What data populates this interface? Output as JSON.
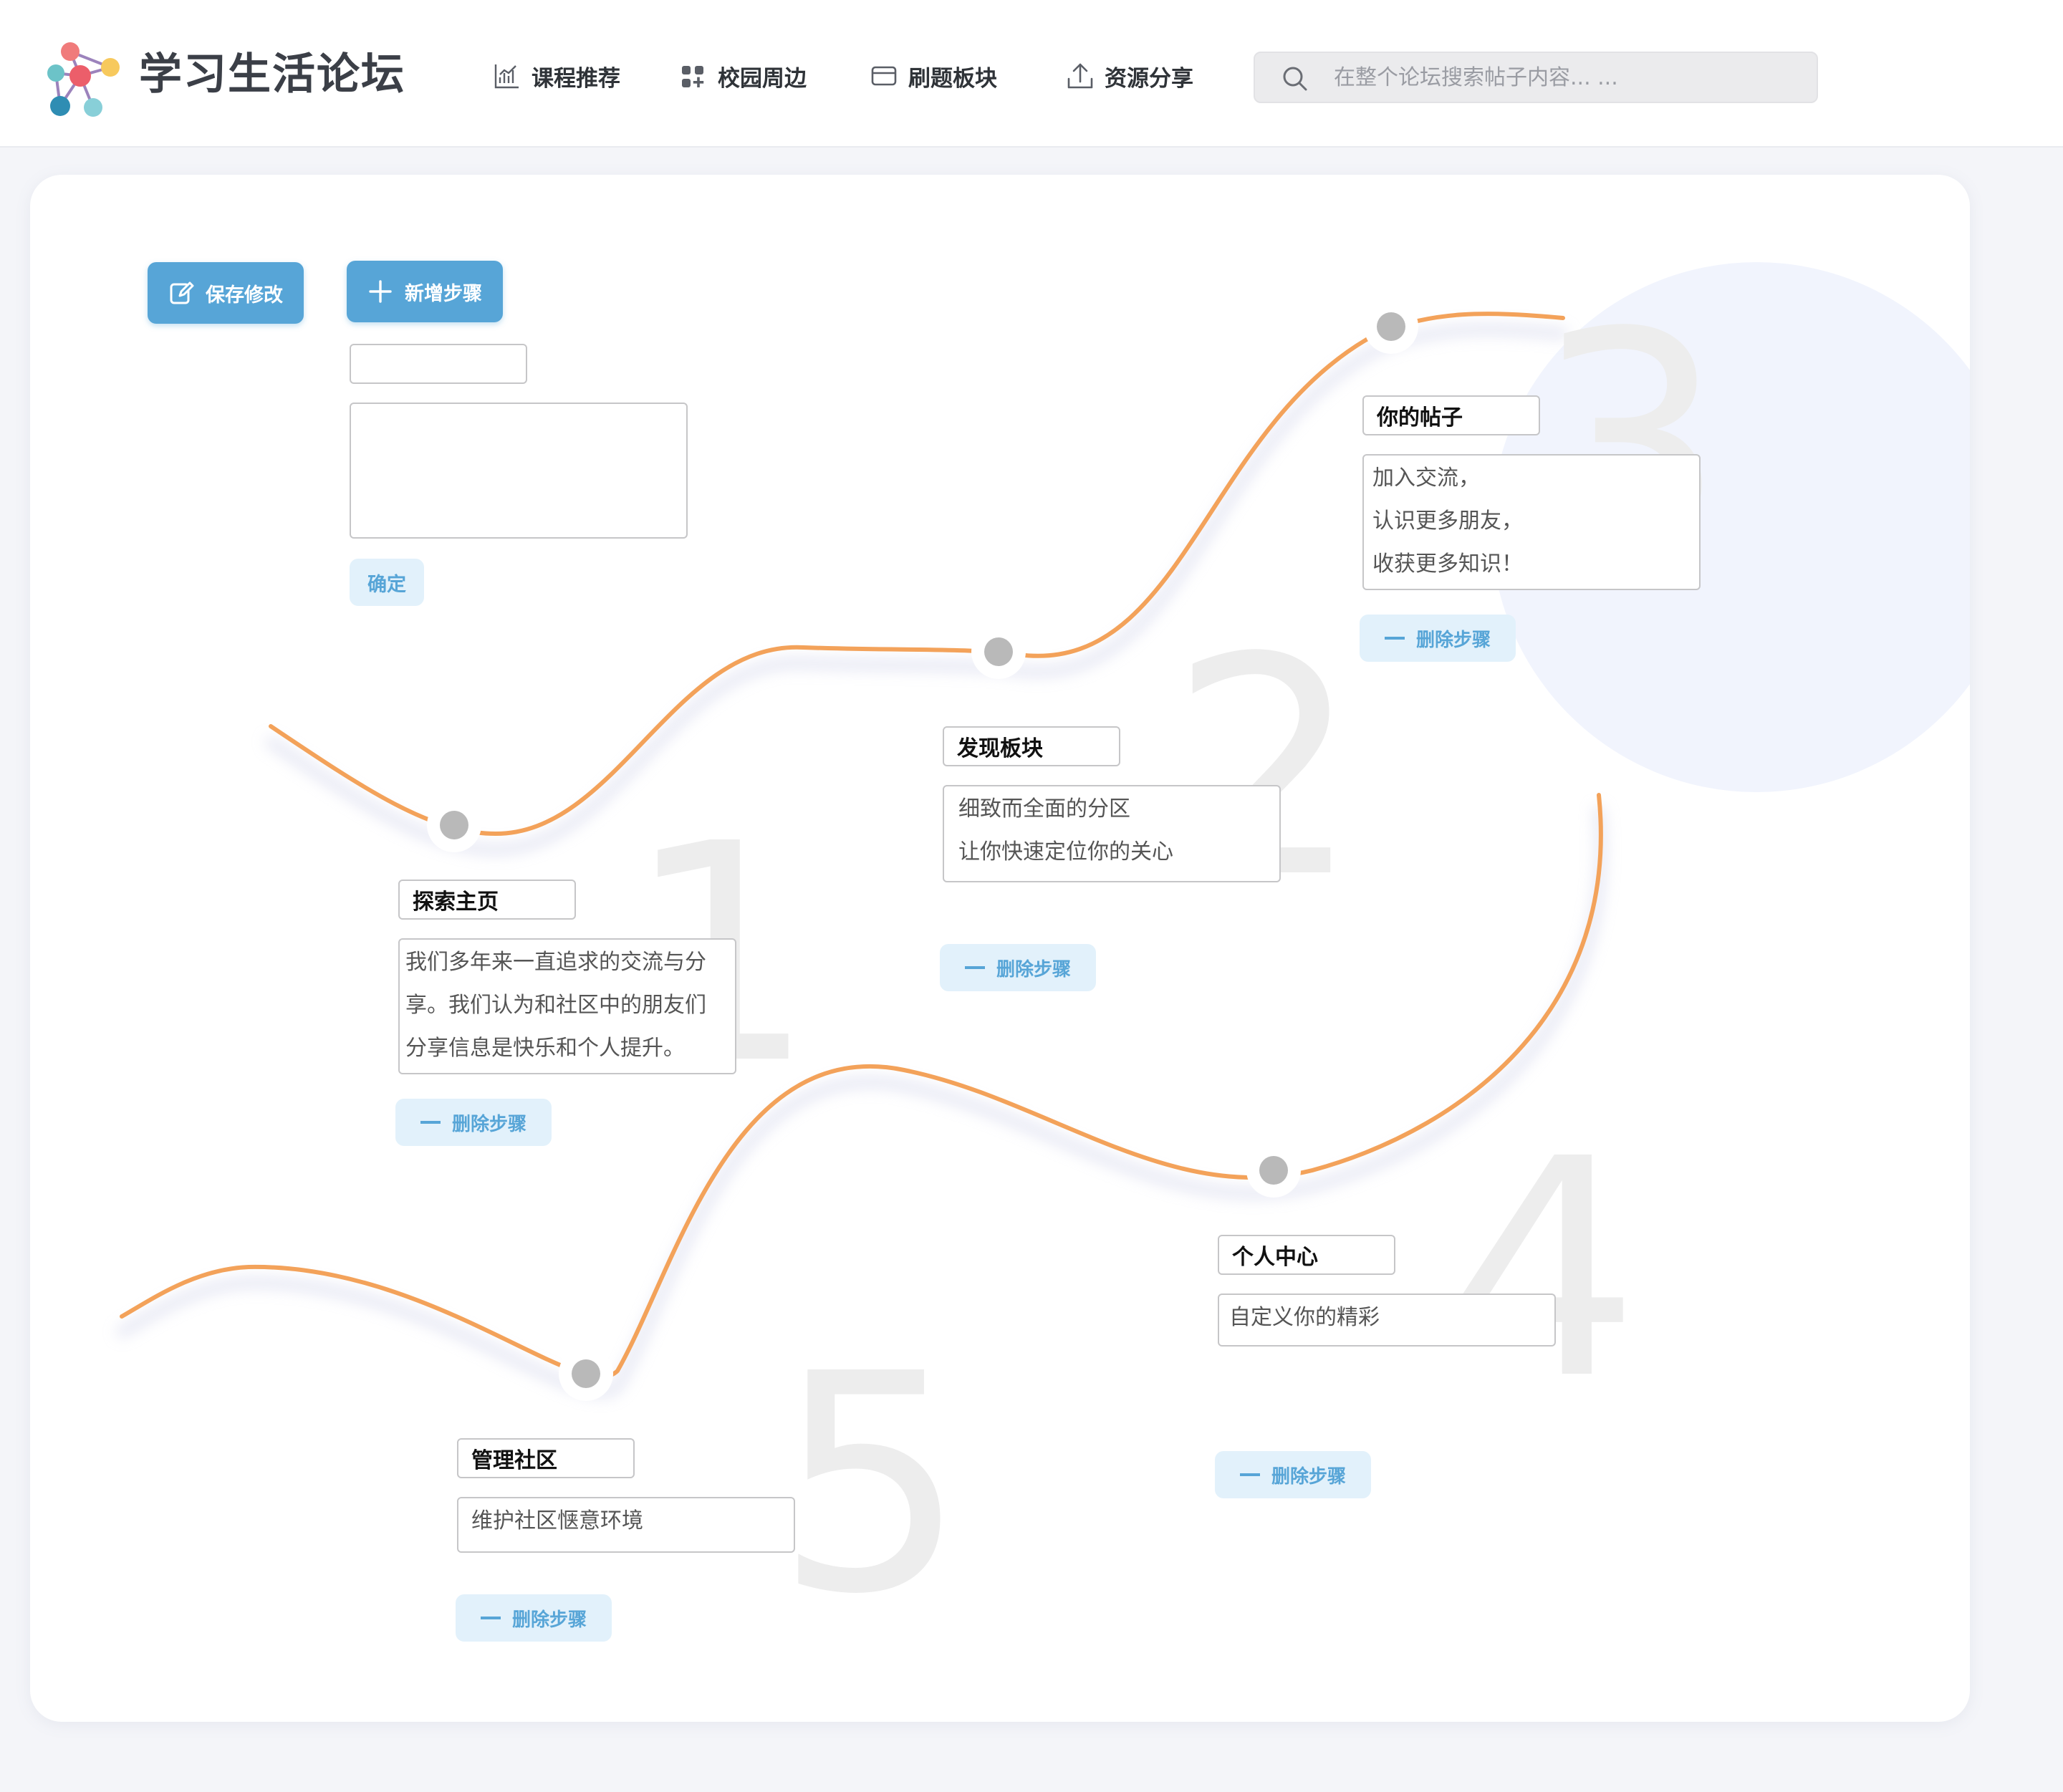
{
  "header": {
    "site_title": "学习生活论坛",
    "nav": [
      {
        "label": "课程推荐",
        "icon": "chart-icon"
      },
      {
        "label": "校园周边",
        "icon": "apps-icon"
      },
      {
        "label": "刷题板块",
        "icon": "card-icon"
      },
      {
        "label": "资源分享",
        "icon": "upload-icon"
      }
    ],
    "search_placeholder": "在整个论坛搜索帖子内容... ..."
  },
  "toolbar": {
    "save_label": "保存修改",
    "add_label": "新增步骤"
  },
  "new_step": {
    "title_value": "",
    "desc_value": "",
    "confirm_label": "确定"
  },
  "steps": [
    {
      "number": "1",
      "title": "探索主页",
      "desc": "我们多年来一直追求的交流与分享。我们认为和社区中的朋友们分享信息是快乐和个人提升。",
      "delete_label": "删除步骤"
    },
    {
      "number": "2",
      "title": "发现板块",
      "desc": "细致而全面的分区\n让你快速定位你的关心",
      "delete_label": "删除步骤"
    },
    {
      "number": "3",
      "title": "你的帖子",
      "desc": "加入交流，\n认识更多朋友，\n收获更多知识！",
      "delete_label": "删除步骤"
    },
    {
      "number": "4",
      "title": "个人中心",
      "desc": "自定义你的精彩",
      "delete_label": "删除步骤"
    },
    {
      "number": "5",
      "title": "管理社区",
      "desc": "维护社区惬意环境",
      "delete_label": "删除步骤"
    }
  ],
  "colors": {
    "accent": "#57a5d7",
    "curve": "#f3a25a",
    "dot": "#b9b9b9"
  }
}
